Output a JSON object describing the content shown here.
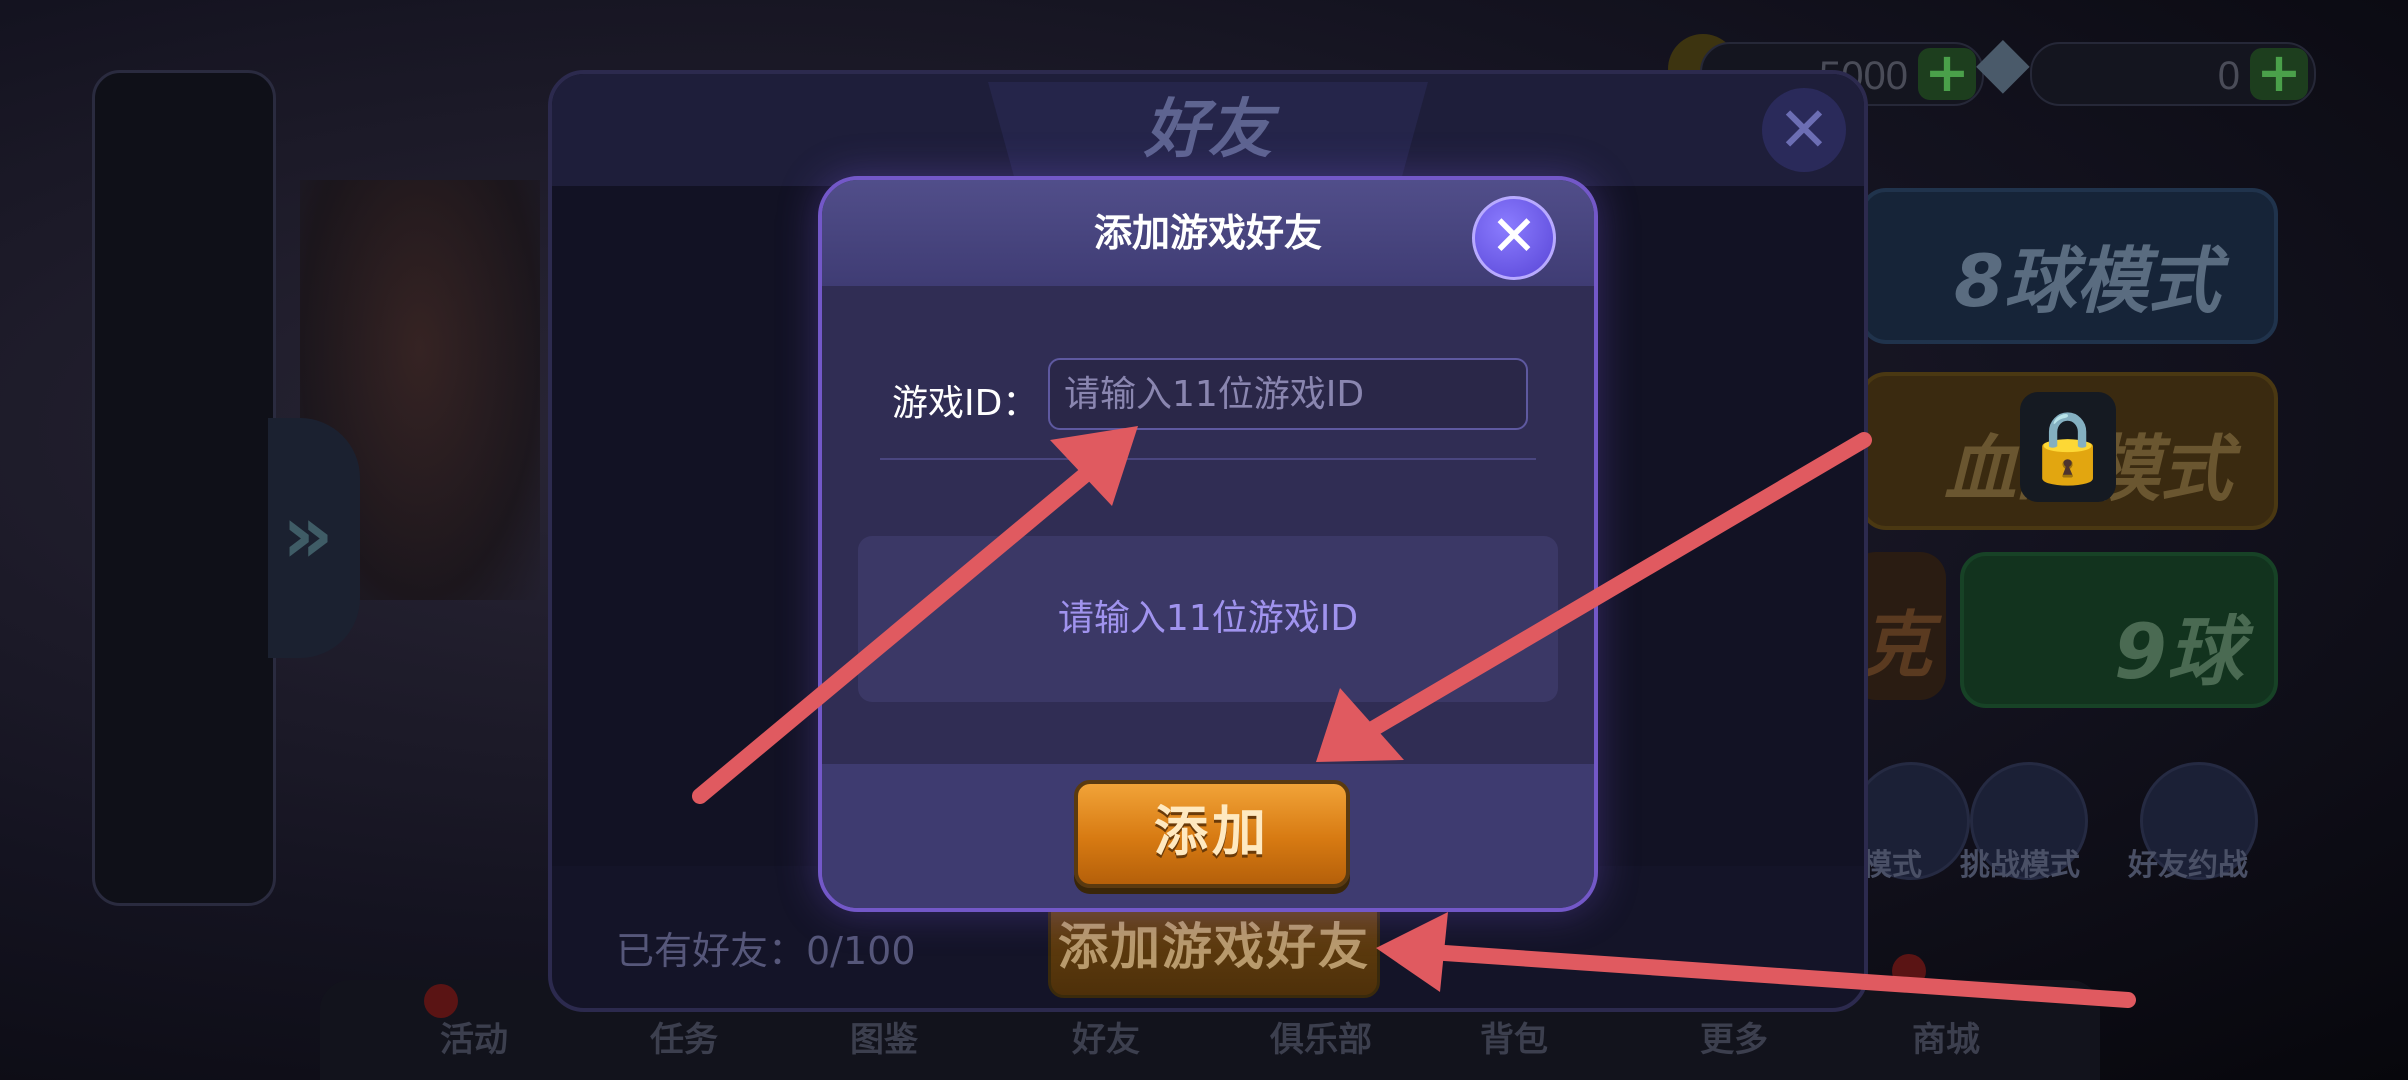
{
  "background": {
    "currency": {
      "coins": "5000",
      "diamonds": "0"
    },
    "modes": {
      "eight_ball": "8球模式",
      "blood": "血战模式",
      "k": "克",
      "nine_ball": "9球"
    },
    "round_buttons": [
      "模式",
      "挑战模式",
      "好友约战"
    ],
    "bottom_nav": [
      "活动",
      "任务",
      "图鉴",
      "好友",
      "俱乐部",
      "背包",
      "更多",
      "商城"
    ]
  },
  "friends_panel": {
    "title": "好友",
    "close_symbol": "✕",
    "friend_count": "已有好友：0/100",
    "add_friend_button": "添加游戏好友"
  },
  "modal": {
    "title": "添加游戏好友",
    "close_symbol": "✕",
    "id_label": "游戏ID：",
    "id_placeholder": "请输入11位游戏ID",
    "id_value": "",
    "hint": "请输入11位游戏ID",
    "add_button": "添加"
  },
  "annotation_color": "#e05a60"
}
